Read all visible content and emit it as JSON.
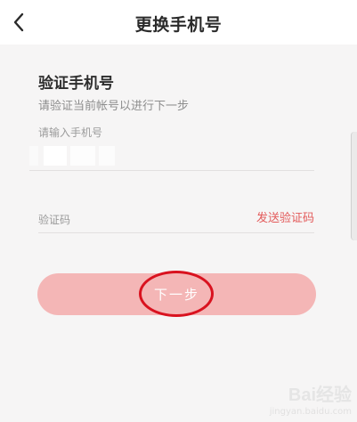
{
  "header": {
    "title": "更换手机号",
    "back_icon": "chevron-left-icon"
  },
  "form": {
    "title": "验证手机号",
    "subtitle": "请验证当前帐号以进行下一步",
    "phone_label": "请输入手机号",
    "code_placeholder": "验证码",
    "send_code_label": "发送验证码",
    "next_label": "下一步"
  },
  "colors": {
    "accent": "#e35a5a",
    "button_bg": "#f4b6b6",
    "highlight": "#d9121f"
  },
  "watermark": {
    "brand": "Bai经验",
    "site": "jingyan.baidu.com"
  }
}
